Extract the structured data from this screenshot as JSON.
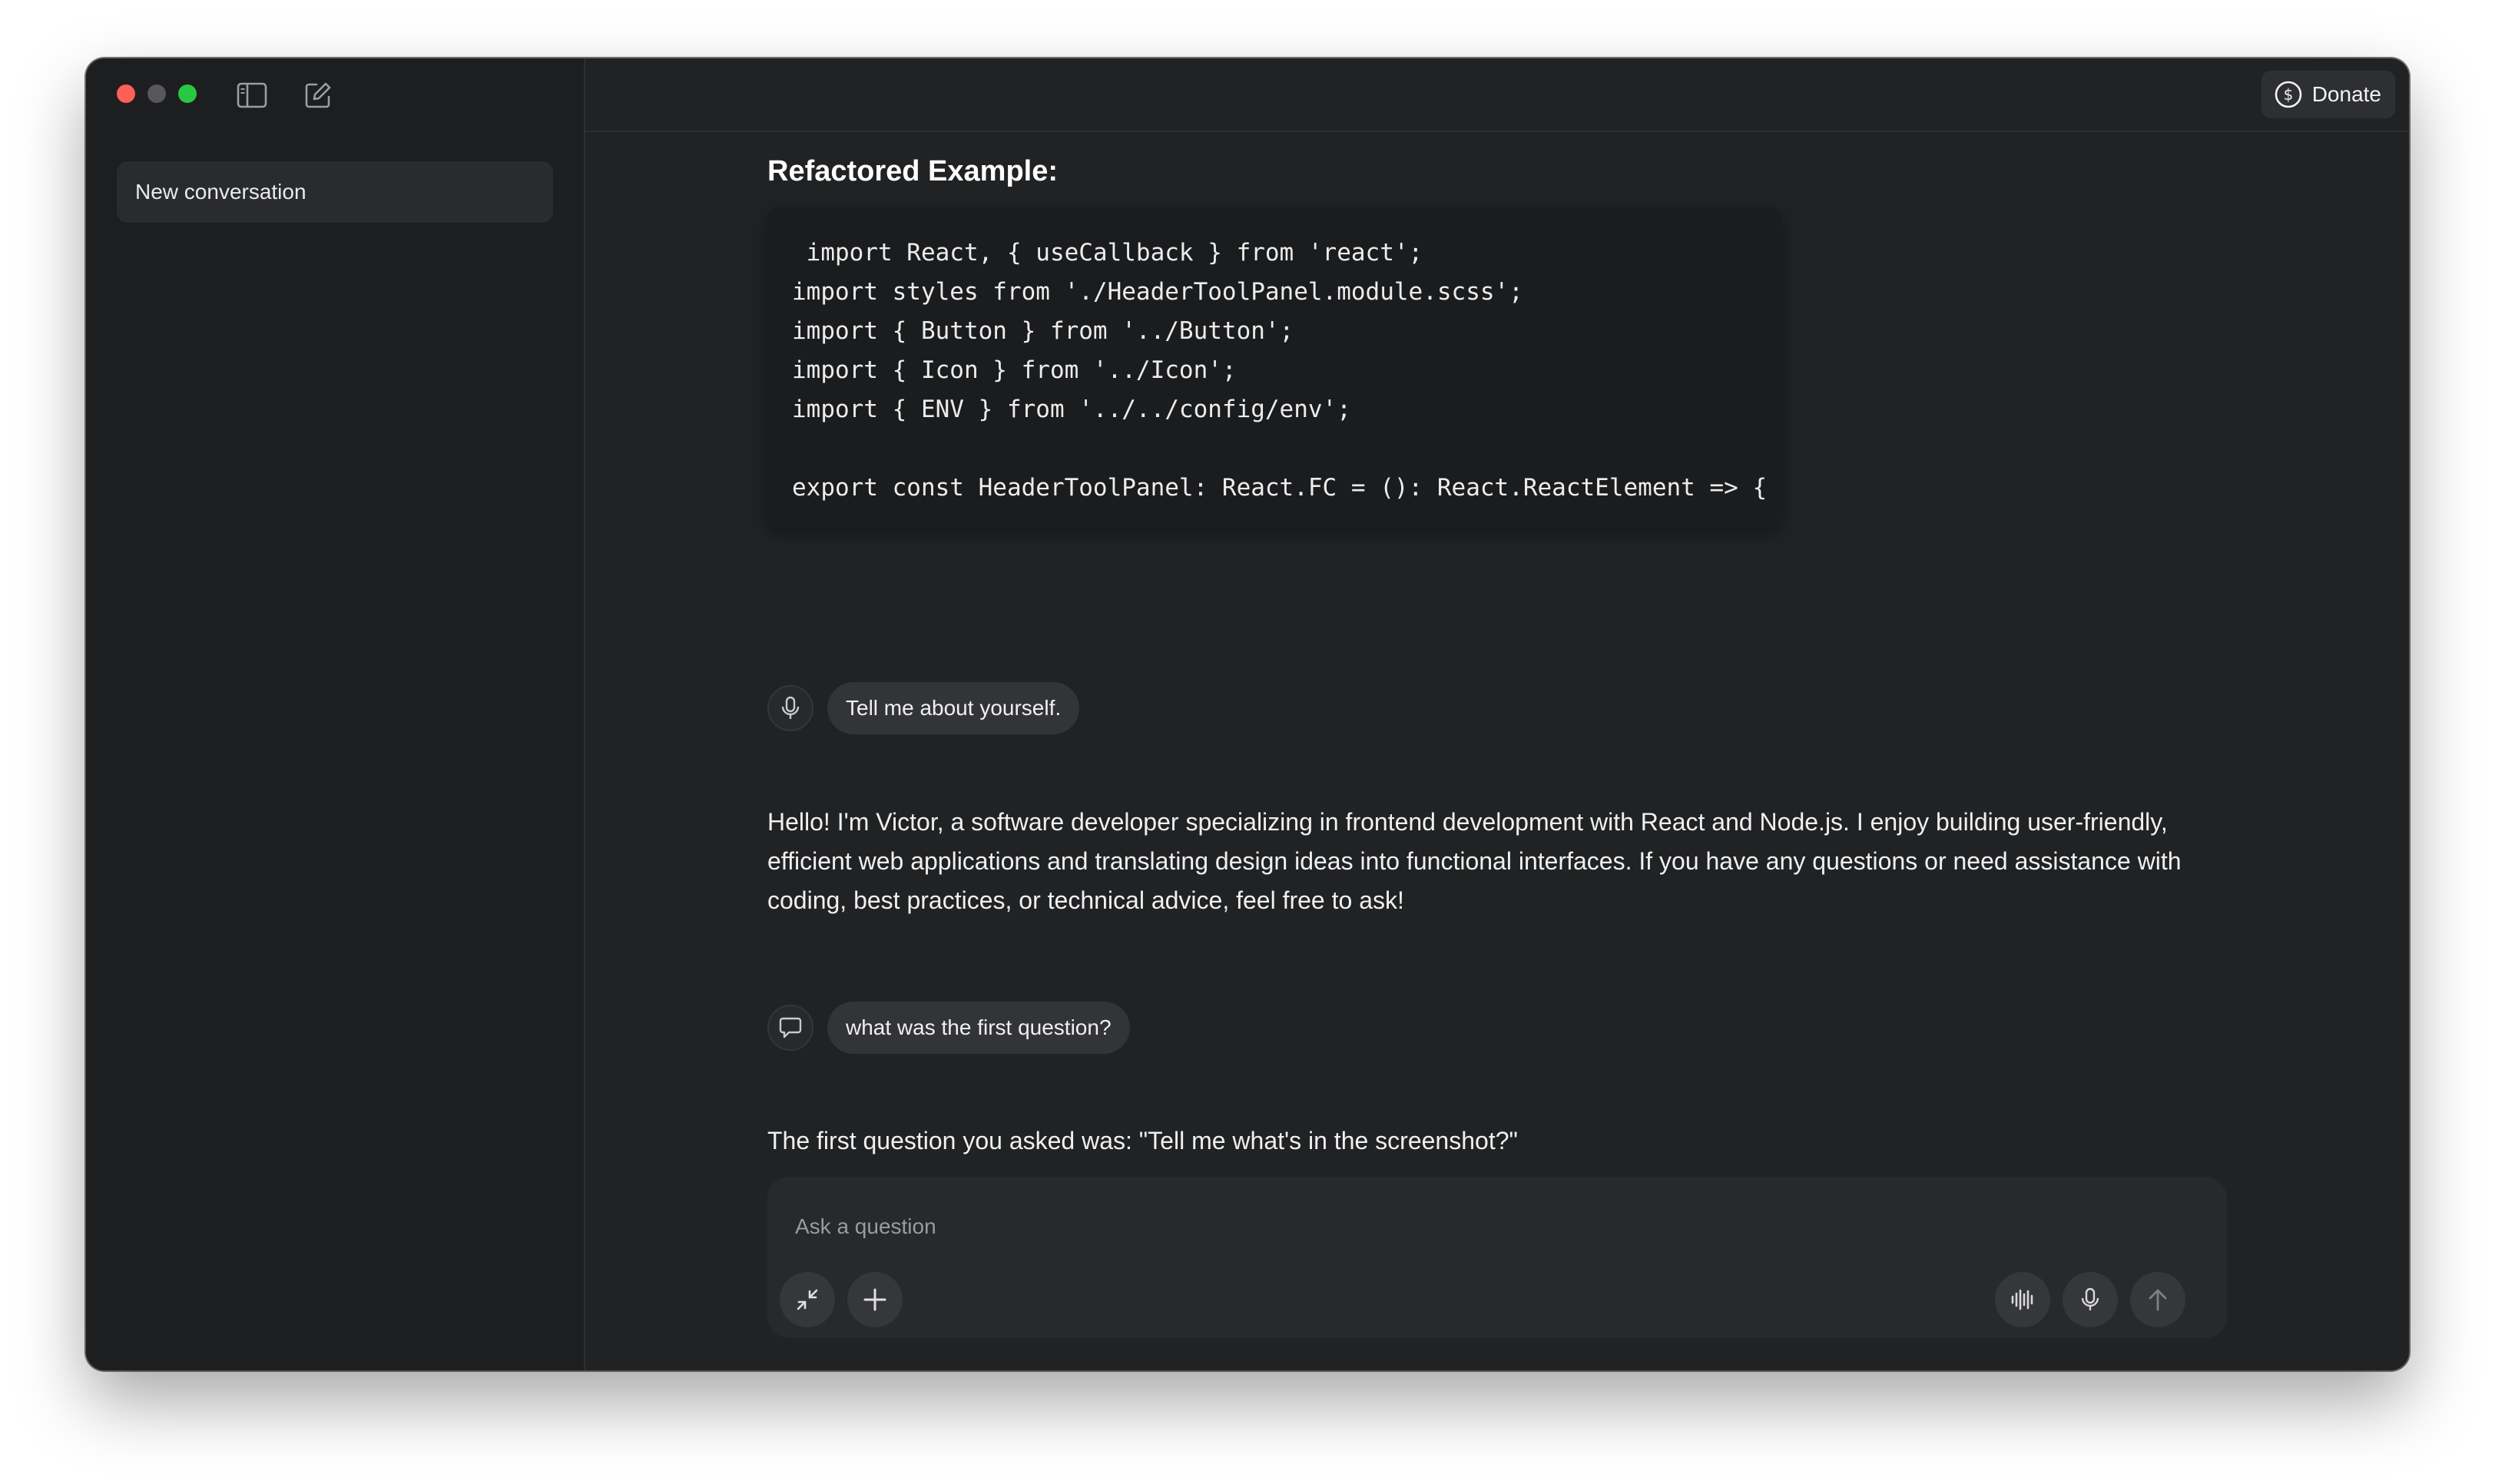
{
  "sidebar": {
    "toggle_icon": "sidebar-toggle-icon",
    "compose_icon": "compose-icon",
    "conversations": [
      {
        "label": "New conversation"
      }
    ]
  },
  "header": {
    "donate_label": "Donate",
    "donate_icon": "dollar-circle-icon"
  },
  "thread": {
    "section_title": "Refactored Example:",
    "code": " import React, { useCallback } from 'react';\nimport styles from './HeaderToolPanel.module.scss';\nimport { Button } from '../Button';\nimport { Icon } from '../Icon';\nimport { ENV } from '../../config/env';\n\nexport const HeaderToolPanel: React.FC = (): React.ReactElement => {",
    "user_message_1": "Tell me about yourself.",
    "user_message_1_icon": "microphone-icon",
    "assistant_reply_1": "Hello! I'm Victor, a software developer specializing in frontend development with React and Node.js. I enjoy building user-friendly, efficient web applications and translating design ideas into functional interfaces. If you have any questions or need assistance with coding, best practices, or technical advice, feel free to ask!",
    "user_message_2": "what was the first question?",
    "user_message_2_icon": "chat-bubble-icon",
    "assistant_reply_2": "The first question you asked was: \"Tell me what's in the screenshot?\""
  },
  "composer": {
    "placeholder": "Ask a question",
    "value": ""
  },
  "colors": {
    "window_bg": "#212224",
    "sidebar_bg": "#1d1e20",
    "bubble_bg": "#333437",
    "code_bg": "#1b1c1e"
  }
}
